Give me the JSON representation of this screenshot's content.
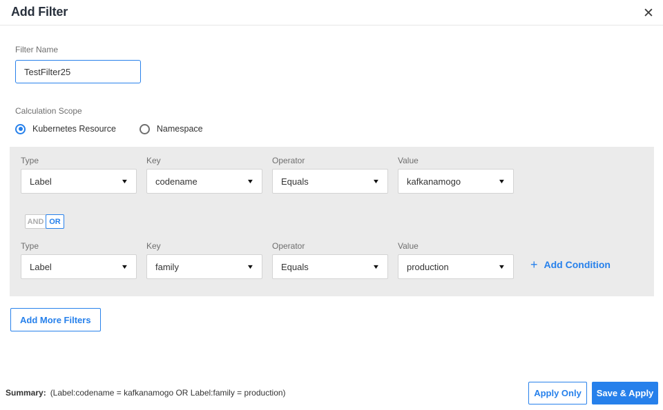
{
  "dialog": {
    "title": "Add Filter",
    "close_icon": "✕"
  },
  "filter_name": {
    "label": "Filter Name",
    "value": "TestFilter25"
  },
  "calculation_scope": {
    "label": "Calculation Scope",
    "options": [
      {
        "label": "Kubernetes Resource",
        "selected": true
      },
      {
        "label": "Namespace",
        "selected": false
      }
    ]
  },
  "conditions": {
    "labels": {
      "type": "Type",
      "key": "Key",
      "operator": "Operator",
      "value": "Value"
    },
    "rows": [
      {
        "type": "Label",
        "key": "codename",
        "operator": "Equals",
        "value": "kafkanamogo"
      },
      {
        "type": "Label",
        "key": "family",
        "operator": "Equals",
        "value": "production"
      }
    ],
    "logic_toggle": {
      "and_label": "AND",
      "or_label": "OR",
      "selected": "OR"
    },
    "add_condition": {
      "plus_icon": "+",
      "label": "Add Condition"
    }
  },
  "add_more_filters_label": "Add More Filters",
  "footer": {
    "summary_label": "Summary:",
    "summary_text": "(Label:codename = kafkanamogo OR Label:family = production)",
    "apply_only_label": "Apply Only",
    "save_apply_label": "Save & Apply"
  },
  "colors": {
    "accent": "#2680eb",
    "panel_background": "#ebebeb",
    "title_text": "#29313d"
  }
}
